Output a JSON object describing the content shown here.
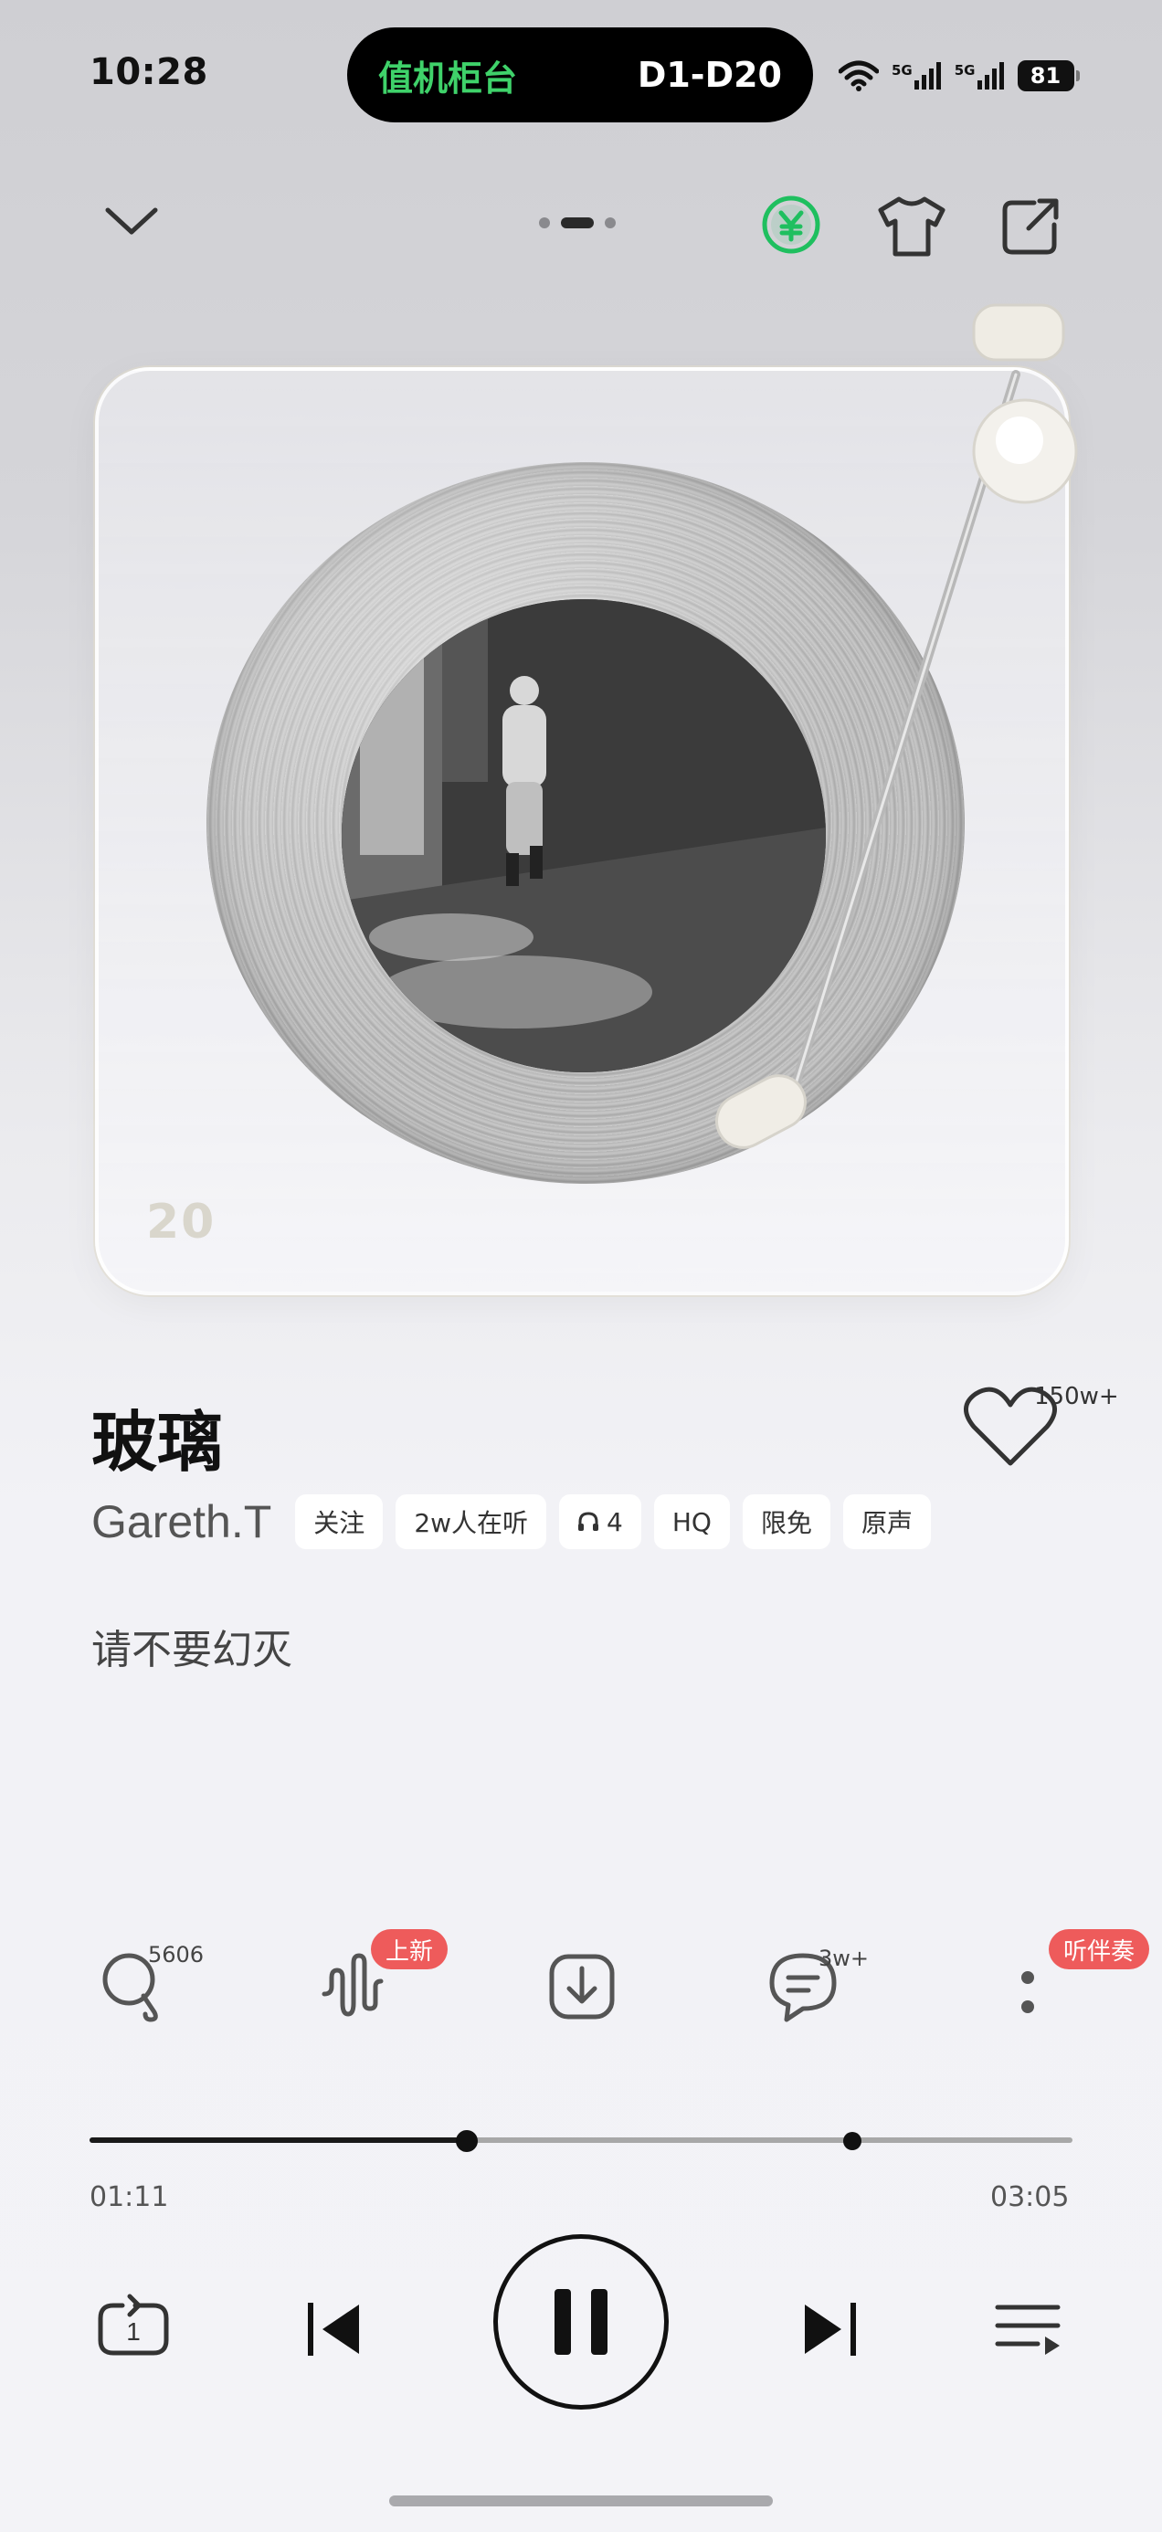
{
  "status_bar": {
    "time": "10:28",
    "island_left": "值机柜台",
    "island_right": "D1-D20",
    "signal_1": "5G",
    "signal_2": "5G",
    "battery": "81"
  },
  "top_bar": {
    "page_dots": 3,
    "active_page": 1,
    "accent_color": "#1fbf5f"
  },
  "card": {
    "brand_mark": "20"
  },
  "song": {
    "title": "玻璃",
    "artist": "Gareth.T",
    "like_count": "150w+",
    "tags": [
      "关注",
      "2w人在听",
      "4",
      "HQ",
      "限免",
      "原声"
    ],
    "lyric": "请不要幻灭"
  },
  "actions": {
    "search_count": "5606",
    "new_badge": "上新",
    "comment_count": "3w+",
    "accompaniment_badge": "听伴奏"
  },
  "progress": {
    "current": "01:11",
    "total": "03:05",
    "fraction": 0.384,
    "marker_fraction": 0.776
  },
  "controls": {
    "repeat_count": "1"
  }
}
